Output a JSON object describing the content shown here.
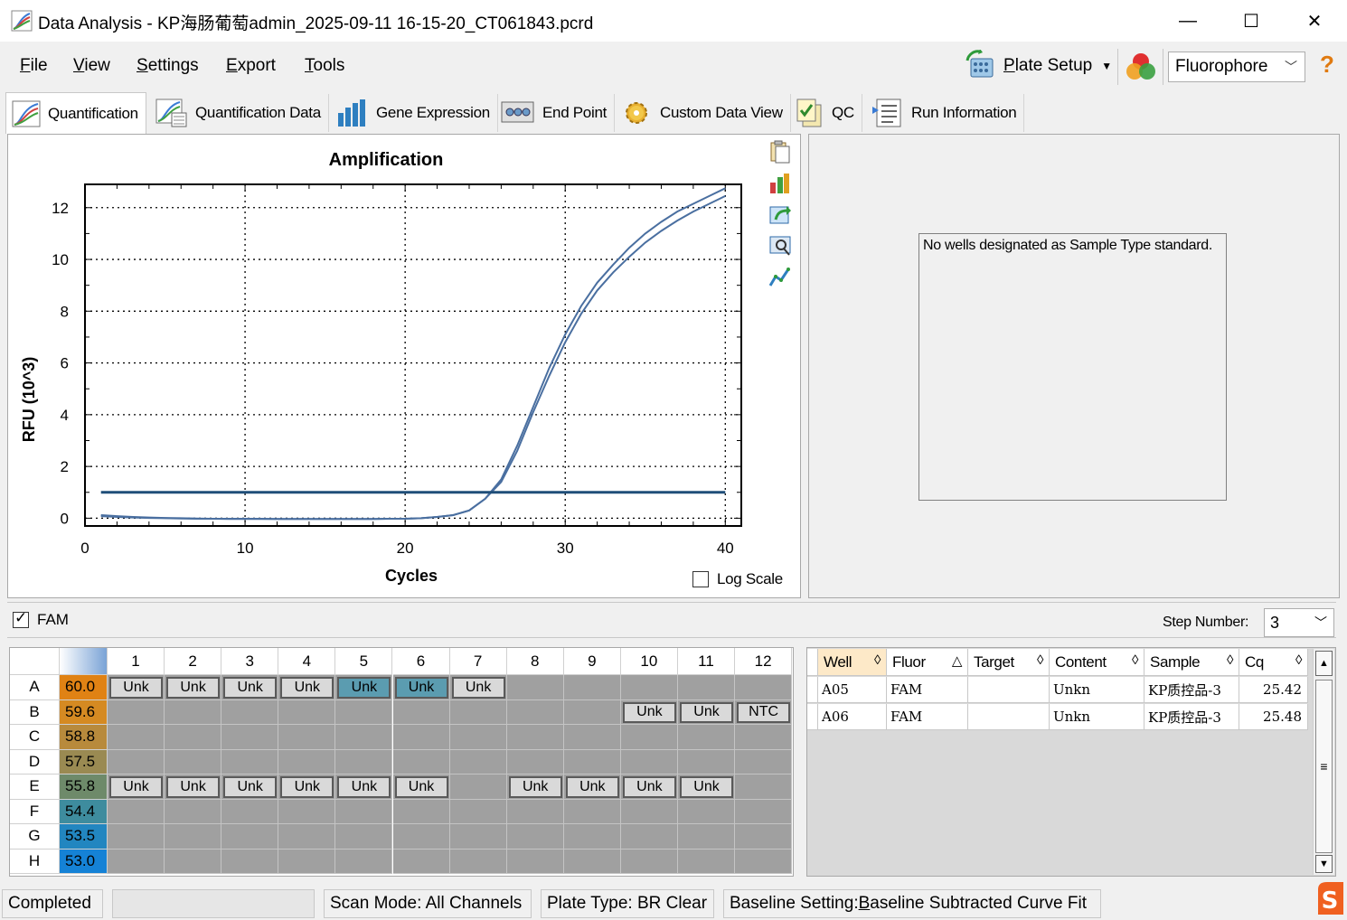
{
  "window": {
    "title": "Data Analysis - KP海肠葡萄admin_2025-09-11 16-15-20_CT061843.pcrd",
    "minimize": "—",
    "maximize": "☐",
    "close": "✕"
  },
  "menu": {
    "items": [
      {
        "label": "File",
        "underline": "F",
        "rest": "ile"
      },
      {
        "label": "View",
        "underline": "V",
        "rest": "iew"
      },
      {
        "label": "Settings",
        "underline": "S",
        "rest": "ettings"
      },
      {
        "label": "Export",
        "underline": "E",
        "rest": "xport"
      },
      {
        "label": "Tools",
        "underline": "T",
        "rest": "ools"
      }
    ],
    "plate_setup_label": "Plate Setup",
    "plate_setup_underline": "P",
    "plate_setup_rest": "late Setup",
    "fluorophore_selected": "Fluorophore",
    "help": "?"
  },
  "tabs": [
    {
      "label": "Quantification",
      "icon": "amplification-icon",
      "active": true
    },
    {
      "label": "Quantification Data",
      "icon": "quant-data-icon",
      "active": false
    },
    {
      "label": "Gene Expression",
      "icon": "bar-chart-icon",
      "active": false
    },
    {
      "label": "End Point",
      "icon": "end-point-icon",
      "active": false
    },
    {
      "label": "Custom Data View",
      "icon": "gear-icon",
      "active": false
    },
    {
      "label": "QC",
      "icon": "qc-icon",
      "active": false
    },
    {
      "label": "Run Information",
      "icon": "run-info-icon",
      "active": false
    }
  ],
  "chart_data": {
    "type": "line",
    "title": "Amplification",
    "xlabel": "Cycles",
    "ylabel": "RFU (10^3)",
    "xlim": [
      0,
      41
    ],
    "ylim": [
      -0.3,
      12.9
    ],
    "xticks": [
      0,
      10,
      20,
      30,
      40
    ],
    "yticks": [
      0,
      2,
      4,
      6,
      8,
      10,
      12
    ],
    "grid": true,
    "series": [
      {
        "x": [
          1,
          2,
          3,
          4,
          5,
          6,
          7,
          8,
          9,
          10,
          11,
          12,
          13,
          14,
          15,
          16,
          17,
          18,
          19,
          20,
          21,
          22,
          23,
          24,
          25,
          26,
          27,
          28,
          29,
          30,
          31,
          32,
          33,
          34,
          35,
          36,
          37,
          38,
          39,
          40
        ],
        "values": [
          0.12,
          0.08,
          0.05,
          0.03,
          0.01,
          0.0,
          -0.01,
          -0.02,
          -0.02,
          -0.02,
          -0.02,
          -0.03,
          -0.03,
          -0.03,
          -0.03,
          -0.03,
          -0.03,
          -0.03,
          -0.02,
          -0.02,
          0.0,
          0.05,
          0.12,
          0.3,
          0.75,
          1.5,
          2.8,
          4.3,
          5.8,
          7.1,
          8.2,
          9.1,
          9.8,
          10.45,
          11.0,
          11.45,
          11.85,
          12.15,
          12.45,
          12.75
        ]
      },
      {
        "x": [
          1,
          2,
          3,
          4,
          5,
          6,
          7,
          8,
          9,
          10,
          11,
          12,
          13,
          14,
          15,
          16,
          17,
          18,
          19,
          20,
          21,
          22,
          23,
          24,
          25,
          26,
          27,
          28,
          29,
          30,
          31,
          32,
          33,
          34,
          35,
          36,
          37,
          38,
          39,
          40
        ],
        "values": [
          0.08,
          0.05,
          0.03,
          0.01,
          0.0,
          -0.01,
          -0.02,
          -0.02,
          -0.03,
          -0.03,
          -0.03,
          -0.03,
          -0.03,
          -0.03,
          -0.03,
          -0.03,
          -0.03,
          -0.03,
          -0.02,
          -0.02,
          0.0,
          0.05,
          0.12,
          0.3,
          0.75,
          1.4,
          2.6,
          4.1,
          5.5,
          6.8,
          7.9,
          8.8,
          9.5,
          10.1,
          10.65,
          11.1,
          11.5,
          11.85,
          12.15,
          12.45
        ]
      }
    ],
    "threshold": 1.0,
    "log_scale_label": "Log Scale",
    "log_scale_checked": false
  },
  "standard_panel": {
    "message": "No wells designated as Sample Type standard."
  },
  "fluor_bar": {
    "fam_label": "FAM",
    "fam_checked": true,
    "step_label": "Step Number:",
    "step_value": "3"
  },
  "plate": {
    "columns": [
      "1",
      "2",
      "3",
      "4",
      "5",
      "6",
      "7",
      "8",
      "9",
      "10",
      "11",
      "12"
    ],
    "rows": [
      {
        "label": "A",
        "temp": "60.0",
        "color": "#e08214"
      },
      {
        "label": "B",
        "temp": "59.6",
        "color": "#d58a22"
      },
      {
        "label": "C",
        "temp": "58.8",
        "color": "#b88a3c"
      },
      {
        "label": "D",
        "temp": "57.5",
        "color": "#9a8a52"
      },
      {
        "label": "E",
        "temp": "55.8",
        "color": "#6e8a6a"
      },
      {
        "label": "F",
        "temp": "54.4",
        "color": "#3e8c9e"
      },
      {
        "label": "G",
        "temp": "53.5",
        "color": "#2286c0"
      },
      {
        "label": "H",
        "temp": "53.0",
        "color": "#1582d6"
      }
    ],
    "wells": [
      {
        "row": 0,
        "col": 0,
        "label": "Unk",
        "selected": false
      },
      {
        "row": 0,
        "col": 1,
        "label": "Unk",
        "selected": false
      },
      {
        "row": 0,
        "col": 2,
        "label": "Unk",
        "selected": false
      },
      {
        "row": 0,
        "col": 3,
        "label": "Unk",
        "selected": false
      },
      {
        "row": 0,
        "col": 4,
        "label": "Unk",
        "selected": true
      },
      {
        "row": 0,
        "col": 5,
        "label": "Unk",
        "selected": true
      },
      {
        "row": 0,
        "col": 6,
        "label": "Unk",
        "selected": false
      },
      {
        "row": 1,
        "col": 9,
        "label": "Unk",
        "selected": false
      },
      {
        "row": 1,
        "col": 10,
        "label": "Unk",
        "selected": false
      },
      {
        "row": 1,
        "col": 11,
        "label": "NTC",
        "selected": false
      },
      {
        "row": 4,
        "col": 0,
        "label": "Unk",
        "selected": false
      },
      {
        "row": 4,
        "col": 1,
        "label": "Unk",
        "selected": false
      },
      {
        "row": 4,
        "col": 2,
        "label": "Unk",
        "selected": false
      },
      {
        "row": 4,
        "col": 3,
        "label": "Unk",
        "selected": false
      },
      {
        "row": 4,
        "col": 4,
        "label": "Unk",
        "selected": false
      },
      {
        "row": 4,
        "col": 5,
        "label": "Unk",
        "selected": false
      },
      {
        "row": 4,
        "col": 7,
        "label": "Unk",
        "selected": false
      },
      {
        "row": 4,
        "col": 8,
        "label": "Unk",
        "selected": false
      },
      {
        "row": 4,
        "col": 9,
        "label": "Unk",
        "selected": false
      },
      {
        "row": 4,
        "col": 10,
        "label": "Unk",
        "selected": false
      }
    ]
  },
  "results_table": {
    "headers": [
      "Well",
      "Fluor",
      "Target",
      "Content",
      "Sample",
      "Cq"
    ],
    "sort_icons": [
      "◊",
      "△",
      "◊",
      "◊",
      "◊",
      "◊"
    ],
    "rows": [
      [
        "A05",
        "FAM",
        "",
        "Unkn",
        "KP质控品-3",
        "25.42"
      ],
      [
        "A06",
        "FAM",
        "",
        "Unkn",
        "KP质控品-3",
        "25.48"
      ]
    ]
  },
  "status_bar": {
    "state": "Completed",
    "scan_mode": "Scan Mode: All Channels",
    "plate_type": "Plate Type: BR Clear",
    "baseline_prefix": "Baseline Setting: ",
    "baseline_underline": "B",
    "baseline_rest": "aseline Subtracted Curve Fit"
  },
  "colors": {
    "curve": "#4a6fa0",
    "threshold": "#1f4e79",
    "selected_well": "#5b9cb0",
    "empty_well": "#a0a0a0"
  }
}
